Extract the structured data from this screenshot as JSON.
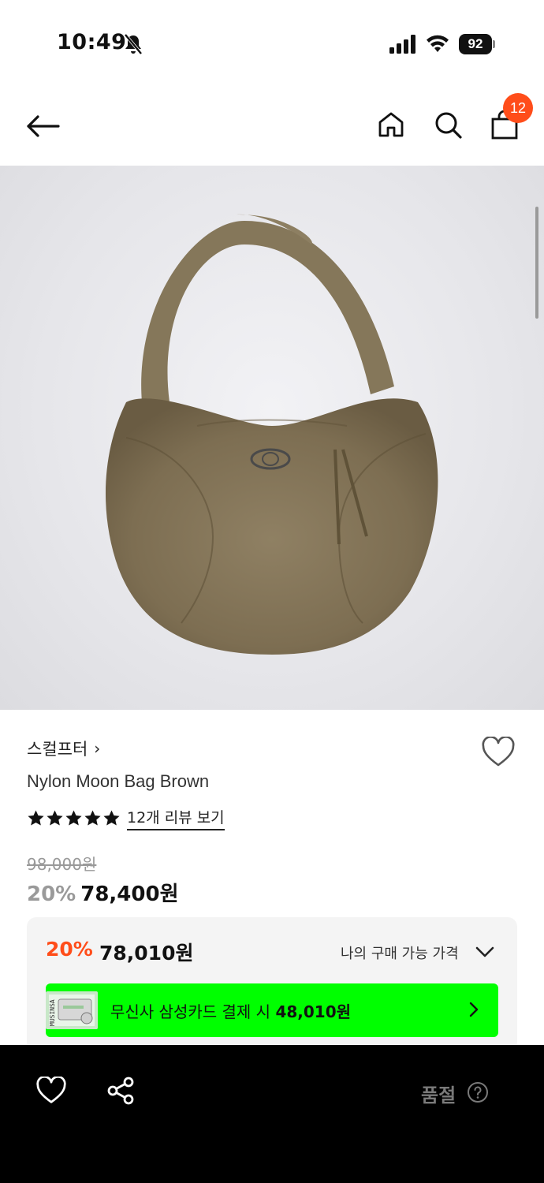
{
  "status_bar": {
    "time": "10:49",
    "battery": "92"
  },
  "header": {
    "cart_count": "12"
  },
  "product": {
    "brand": "스컬프터",
    "brand_chevron": "›",
    "name": "Nylon Moon Bag Brown",
    "rating_stars": 5,
    "review_link": "12개 리뷰 보기",
    "original_price": "98,000원",
    "discount_rate": "20%",
    "sale_price": "78,400원"
  },
  "member_price": {
    "rate": "20%",
    "price": "78,010원",
    "label": "나의 구매 가능 가격",
    "banner_text_prefix": "무신사 삼성카드 결제 시 ",
    "banner_price": "48,010원",
    "thumb_tag": "MUSINSA"
  },
  "bottom_bar": {
    "status": "품절"
  },
  "colors": {
    "accent_orange": "#ff4d1a",
    "banner_green": "#00ff00",
    "bag_brown": "#8a7a5e"
  },
  "icons": [
    "back-arrow-icon",
    "home-icon",
    "search-icon",
    "shopping-bag-icon",
    "heart-icon",
    "share-icon",
    "help-circle-icon",
    "chevron-down-icon",
    "chevron-right-icon",
    "star-icon",
    "bell-off-icon",
    "signal-icon",
    "wifi-icon",
    "battery-icon"
  ]
}
